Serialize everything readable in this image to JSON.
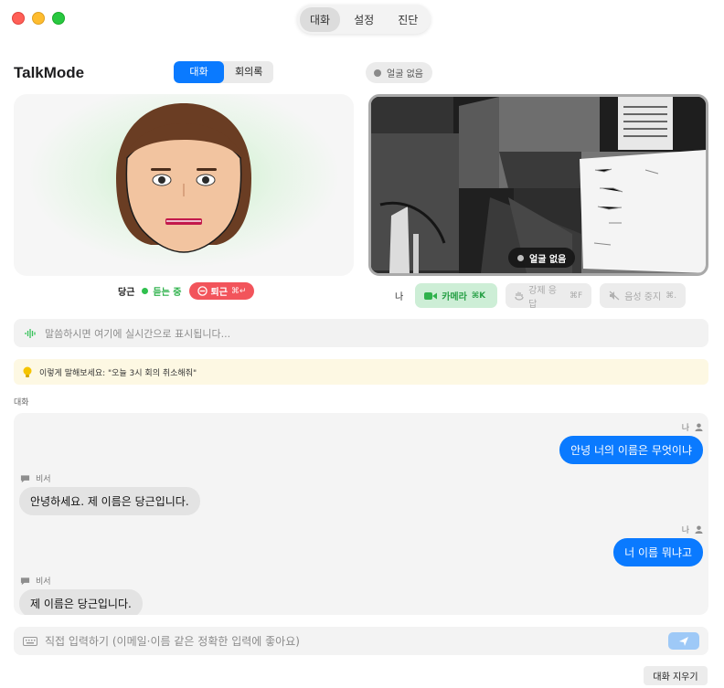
{
  "window": {
    "tabs": [
      {
        "label": "대화",
        "active": true
      },
      {
        "label": "설정",
        "active": false
      },
      {
        "label": "진단",
        "active": false
      }
    ]
  },
  "header": {
    "title": "TalkMode",
    "mode_tabs": [
      {
        "label": "대화",
        "active": true
      },
      {
        "label": "회의록",
        "active": false
      }
    ],
    "face_status": "얼굴 없음"
  },
  "avatar": {
    "name": "당근",
    "status": "듣는 중",
    "leave_label": "퇴근",
    "leave_shortcut": "⌘↵"
  },
  "camera": {
    "overlay_badge": "얼굴 없음",
    "me_label": "나",
    "controls": [
      {
        "label": "카메라",
        "shortcut": "⌘K",
        "enabled": true
      },
      {
        "label": "강제 응답",
        "shortcut": "⌘F",
        "enabled": false
      },
      {
        "label": "음성 중지",
        "shortcut": "⌘.",
        "enabled": false
      }
    ]
  },
  "transcript": {
    "placeholder": "말씀하시면 여기에 실시간으로 표시됩니다..."
  },
  "hint": {
    "text": "이렇게 말해보세요: \"오늘 3시 회의 취소해줘\""
  },
  "conversation": {
    "section_label": "대화",
    "messages": [
      {
        "sender": "나",
        "role": "user",
        "text": "안녕 너의 이름은 무엇이냐"
      },
      {
        "sender": "비서",
        "role": "assistant",
        "text": "안녕하세요. 제 이름은 당근입니다."
      },
      {
        "sender": "나",
        "role": "user",
        "text": "너 이름 뭐냐고"
      },
      {
        "sender": "비서",
        "role": "assistant",
        "text": "제 이름은 당근입니다."
      }
    ]
  },
  "composer": {
    "placeholder": "직접 입력하기 (이메일·이름 같은 정확한 입력에 좋아요)"
  },
  "footer": {
    "clear_label": "대화 지우기"
  },
  "colors": {
    "accent": "#0a7aff",
    "listening": "#30c04e",
    "leave": "#f2545b",
    "camera_on": "#27a046"
  }
}
